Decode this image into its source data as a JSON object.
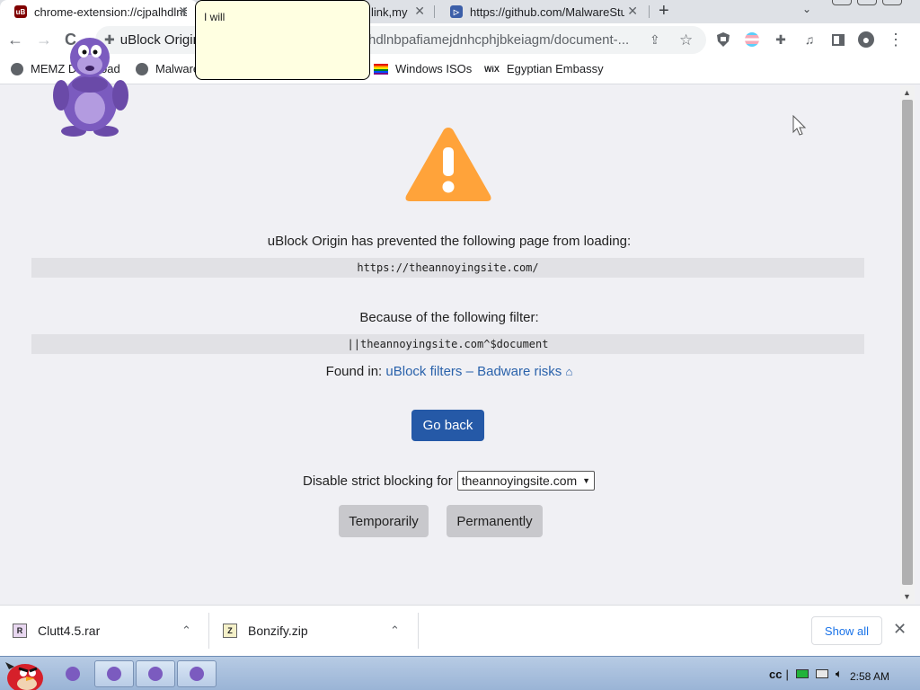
{
  "tabs": [
    {
      "title": "chrome-extension://cjpalhdlnbpafiamejdnhcphjbkeiagm/document-blocked.html",
      "close": "✕",
      "favicon": "uB"
    },
    {
      "title": "link,my",
      "close": "✕"
    },
    {
      "title": "https://github.com/MalwareStudio",
      "close": "✕"
    }
  ],
  "newtab_label": "+",
  "tabstrip_menu": "⌄",
  "toolbar": {
    "back": "←",
    "forward": "→",
    "reload": "C",
    "site_name": "uBlock Origin",
    "url": "hdlnbpafiamejdnhcphjbkeiagm/document-...",
    "share": "⇪",
    "star": "☆",
    "menu": "⋮"
  },
  "bookmarks": [
    {
      "label": "MEMZ Download"
    },
    {
      "label": "Malware"
    },
    {
      "label": "Windows ISOs"
    },
    {
      "label": "Egyptian Embassy"
    }
  ],
  "bookmark_wix": "WiX",
  "bubble_text": "I will",
  "page": {
    "prevented_text": "uBlock Origin has prevented the following page from loading:",
    "blocked_url": "https://theannoyingsite.com/",
    "filter_heading": "Because of the following filter:",
    "filter": "||theannoyingsite.com^$document",
    "found_in_label": "Found in:",
    "found_in_link": "uBlock filters – Badware risks",
    "go_back": "Go back",
    "disable_label": "Disable strict blocking for",
    "disable_select_value": "theannoyingsite.com",
    "temporarily": "Temporarily",
    "permanently": "Permanently"
  },
  "downloads": {
    "items": [
      {
        "name": "Clutt4.5.rar"
      },
      {
        "name": "Bonzify.zip"
      }
    ],
    "show_all": "Show all",
    "close": "✕"
  },
  "taskbar": {
    "tray_cc": "cc",
    "clock": "2:58 AM"
  },
  "colors": {
    "warning": "#ffa33a",
    "primary_button": "#2559a7",
    "link": "#2a62ab",
    "bonzi": "#7b5bbf"
  }
}
